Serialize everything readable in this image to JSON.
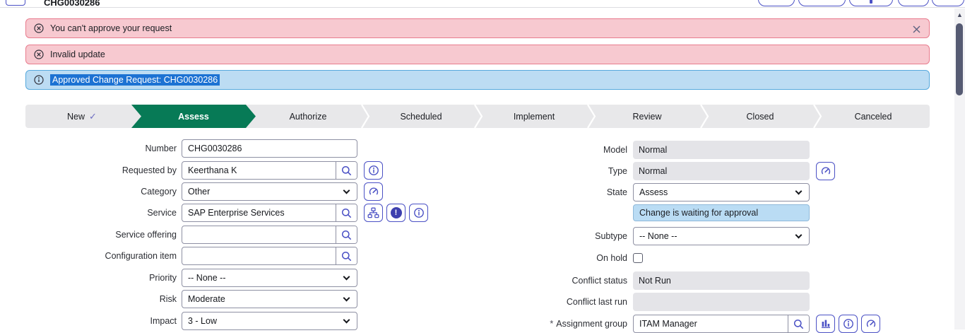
{
  "header": {
    "title": "CHG0030286"
  },
  "banners": [
    {
      "type": "error",
      "icon": "circle-x-icon",
      "text": "You can't approve your request",
      "closable": true
    },
    {
      "type": "error",
      "icon": "circle-x-icon",
      "text": "Invalid update"
    },
    {
      "type": "info",
      "icon": "circle-info-icon",
      "text": "Approved Change Request: CHG0030286",
      "text_selected": true
    }
  ],
  "process_flow": {
    "stages": [
      {
        "label": "New",
        "check": "✓",
        "completed": true
      },
      {
        "label": "Assess",
        "active": true
      },
      {
        "label": "Authorize"
      },
      {
        "label": "Scheduled"
      },
      {
        "label": "Implement"
      },
      {
        "label": "Review"
      },
      {
        "label": "Closed"
      },
      {
        "label": "Canceled"
      }
    ]
  },
  "form": {
    "required_marker": "*",
    "left": [
      {
        "label": "Number",
        "type": "text",
        "value": "CHG0030286"
      },
      {
        "label": "Requested by",
        "type": "reference",
        "value": "Keerthana K",
        "buttons": [
          "info"
        ]
      },
      {
        "label": "Category",
        "type": "select",
        "value": "Other",
        "buttons": [
          "gauge"
        ]
      },
      {
        "label": "Service",
        "type": "reference",
        "value": "SAP Enterprise Services",
        "buttons": [
          "hierarchy",
          "alert",
          "info"
        ]
      },
      {
        "label": "Service offering",
        "type": "reference",
        "value": ""
      },
      {
        "label": "Configuration item",
        "type": "reference",
        "value": ""
      },
      {
        "label": "Priority",
        "type": "select",
        "value": "-- None --"
      },
      {
        "label": "Risk",
        "type": "select",
        "value": "Moderate"
      },
      {
        "label": "Impact",
        "type": "select",
        "value": "3 - Low"
      }
    ],
    "right": [
      {
        "label": "Model",
        "type": "readonly",
        "value": "Normal"
      },
      {
        "label": "Type",
        "type": "readonly",
        "value": "Normal",
        "buttons": [
          "gauge"
        ]
      },
      {
        "label": "State",
        "type": "select",
        "value": "Assess"
      },
      {
        "label": "",
        "type": "infobox",
        "value": "Change is waiting for approval"
      },
      {
        "label": "Subtype",
        "type": "select",
        "value": "-- None --"
      },
      {
        "label": "On hold",
        "type": "checkbox",
        "checked": false
      },
      {
        "label": "Conflict status",
        "type": "readonly",
        "value": "Not Run"
      },
      {
        "label": "Conflict last run",
        "type": "readonly",
        "value": ""
      },
      {
        "label": "Assignment group",
        "type": "reference",
        "value": "ITAM Manager",
        "required": true,
        "buttons": [
          "chart",
          "info",
          "gauge"
        ]
      }
    ]
  },
  "colors": {
    "accent_indigo": "#4b51c5",
    "flow_active_green": "#077a56",
    "error_bg": "#f7c9d0",
    "error_border": "#e87c8e",
    "info_bg": "#bcdcf3",
    "info_border": "#57a9dd",
    "selection_blue": "#1c72d3",
    "readonly_bg": "#e4e4e8",
    "state_info_bg": "#badcf4"
  }
}
